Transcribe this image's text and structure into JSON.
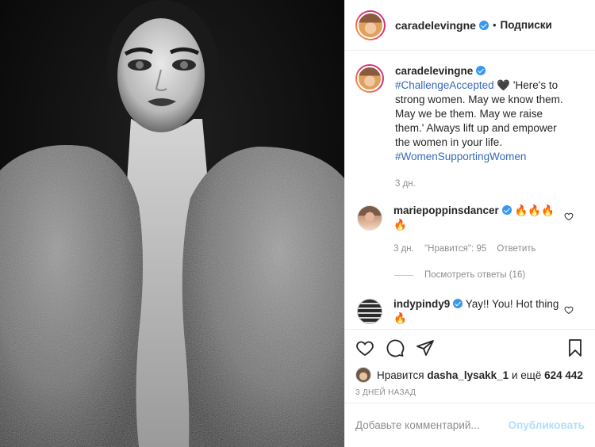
{
  "header": {
    "username": "caradelevingne",
    "separator": "•",
    "follow_label": "Подписки"
  },
  "caption": {
    "username": "caradelevingne",
    "hashtag1": "#ChallengeAccepted",
    "emoji": "🖤",
    "text": " 'Here's to strong women. May we know them. May we be them. May we raise them.' Always lift up and empower the women in your life. ",
    "hashtag2": "#WomenSupportingWomen",
    "time": "3 дн."
  },
  "comments": [
    {
      "username": "mariepoppinsdancer",
      "text": "🔥🔥🔥🔥",
      "time": "3 дн.",
      "likes": "\"Нравится\": 95",
      "reply": "Ответить",
      "view_replies": "Посмотреть ответы (16)"
    },
    {
      "username": "indypindy9",
      "text": "Yay!! You! Hot thing 🔥"
    }
  ],
  "likes": {
    "prefix": "Нравится",
    "user": "dasha_lysakk_1",
    "middle": "и ещё",
    "count": "624 442"
  },
  "date": "3 ДНЕЙ НАЗАД",
  "add_comment": {
    "placeholder": "Добавьте комментарий...",
    "publish": "Опубликовать"
  },
  "colors": {
    "link": "#3569b8",
    "verified": "#3897f0",
    "muted": "#8e8e8e",
    "publish_disabled": "#b2dffc"
  },
  "icons": [
    "verified-icon",
    "heart-icon",
    "comment-icon",
    "share-icon",
    "bookmark-icon"
  ]
}
